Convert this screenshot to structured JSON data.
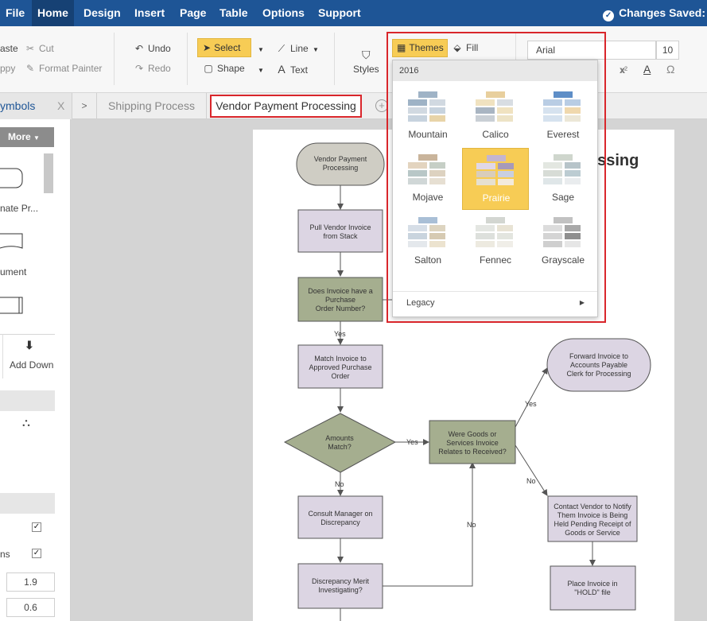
{
  "menu": {
    "items": [
      "File",
      "Home",
      "Design",
      "Insert",
      "Page",
      "Table",
      "Options",
      "Support"
    ],
    "active": "Home",
    "status": "Changes Saved:"
  },
  "ribbon": {
    "clipboard": {
      "paste": "aste",
      "copy": "ppy",
      "cut": "Cut",
      "format_painter": "Format Painter"
    },
    "history": {
      "undo": "Undo",
      "redo": "Redo"
    },
    "tools": {
      "select": "Select",
      "shape": "Shape",
      "line": "Line",
      "text": "Text",
      "styles": "Styles"
    },
    "themes": {
      "themes": "Themes",
      "fill": "Fill"
    },
    "font": {
      "family": "Arial",
      "size": "10",
      "superscript": "x²",
      "sub_hint": "x",
      "font_color": "A",
      "symbol": "Ω"
    }
  },
  "tabs": {
    "symbols": "ymbols",
    "symbols_close": "X",
    "arrow": ">",
    "items": [
      "Shipping Process",
      "Vendor Payment Processing"
    ],
    "active": "Vendor Payment Processing",
    "add": "+"
  },
  "left_panel": {
    "more": "More",
    "shape_labels": [
      "nate Pr...",
      "ument"
    ],
    "add_down": "Add Down",
    "option_label": "ns",
    "values": [
      "1.9",
      "0.6"
    ]
  },
  "page": {
    "title_visible": "essing"
  },
  "flowchart": {
    "nodes": {
      "start": "Vendor Payment Processing",
      "pull": "Pull Vendor Invoice from Stack",
      "does": "Does Invoice have a Purchase Order Number?",
      "match": "Match Invoice to Approved Purchase Order",
      "amounts": "Amounts Match?",
      "were": "Were Goods or Services Invoice Relates to Received?",
      "forward": "Forward Invoice to Accounts Payable Clerk for Processing",
      "contact": "Contact Vendor to Notify Them Invoice is Being Held Pending Receipt of Goods or Service",
      "consult": "Consult Manager on Discrepancy",
      "discrepancy": "Discrepancy Merit Investigating?",
      "hold": "Place Invoice in \"HOLD\" file"
    },
    "edges": {
      "yes": "Yes",
      "no": "No"
    }
  },
  "themes_panel": {
    "year": "2016",
    "themes": [
      {
        "name": "Mountain",
        "colors": [
          "#9fb3c6",
          "#9fb3c6",
          "#d1d9e1",
          "#d1d9e1",
          "#c7d3de",
          "#c7d3de",
          "#e8d4a8",
          "#e8d4a8"
        ]
      },
      {
        "name": "Calico",
        "colors": [
          "#e8cf9d",
          "#f0e2c0",
          "#d8dde2",
          "#a9b5c2",
          "#f0e2c0",
          "#c9cfd5",
          "#ede3c6",
          "#ede3c6"
        ]
      },
      {
        "name": "Everest",
        "colors": [
          "#5e8ec7",
          "#b9cde4",
          "#b9cde4",
          "#d6e2ef",
          "#f0d8ad",
          "#d6e2ef",
          "#ece7d7",
          "#ece7d7"
        ]
      },
      {
        "name": "Mojave",
        "colors": [
          "#c9b49b",
          "#e3d4bf",
          "#c6cfc6",
          "#b8c7c7",
          "#ddd2c0",
          "#d0d7d7",
          "#e6dfd2",
          "#e6dfd2"
        ]
      },
      {
        "name": "Prairie",
        "colors": [
          "#c4b5cf",
          "#e0d7e8",
          "#a79ab9",
          "#d9cdbb",
          "#c9cfe0",
          "#e6e0d0",
          "#f3eadb",
          "#f3eadb"
        ]
      },
      {
        "name": "Sage",
        "colors": [
          "#cfd6cd",
          "#e3e7e1",
          "#b7c4c9",
          "#d7dcd6",
          "#bcccd2",
          "#dfe6e8",
          "#e9ecee",
          "#e9ecee"
        ]
      },
      {
        "name": "Salton",
        "colors": [
          "#a9bfd6",
          "#d6dee7",
          "#ddd4c0",
          "#c9d4de",
          "#d6cab2",
          "#e4e8ec",
          "#ece3cf",
          "#ece3cf"
        ]
      },
      {
        "name": "Fennec",
        "colors": [
          "#d3d6d1",
          "#e4e6e2",
          "#e8e3d4",
          "#dde0dc",
          "#e3e5df",
          "#edeae0",
          "#f0eee8",
          "#f0eee8"
        ]
      },
      {
        "name": "Grayscale",
        "colors": [
          "#c2c2c2",
          "#dcdcdc",
          "#a8a8a8",
          "#d4d4d4",
          "#8f8f8f",
          "#cfcfcf",
          "#e6e6e6",
          "#e6e6e6"
        ]
      }
    ],
    "selected": "Prairie",
    "legacy": "Legacy"
  },
  "colors": {
    "menu_bg": "#1e5596",
    "accent_yellow": "#f7cc55",
    "highlight_red": "#d9262b",
    "node_purple": "#dcd5e3",
    "node_green": "#a5ae8f",
    "start_gray": "#cfcdc4"
  }
}
